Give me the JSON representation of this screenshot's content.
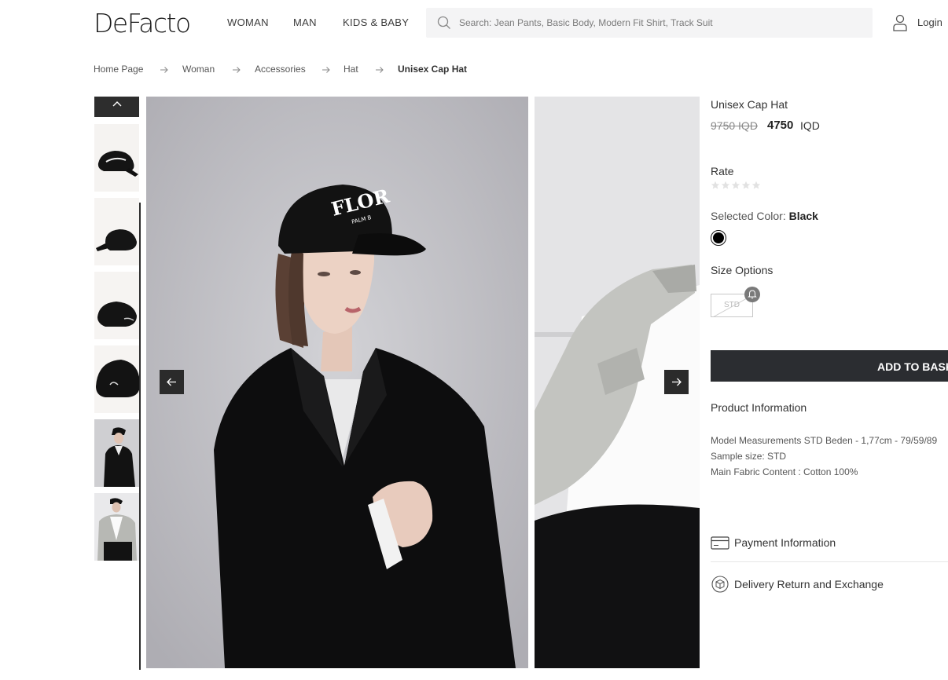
{
  "header": {
    "logo": "DeFacto",
    "nav": [
      "WOMAN",
      "MAN",
      "KIDS & BABY"
    ],
    "search_placeholder": "Search: Jean Pants, Basic Body, Modern Fit Shirt, Track Suit",
    "login_label": "Login"
  },
  "breadcrumb": [
    "Home Page",
    "Woman",
    "Accessories",
    "Hat",
    "Unisex Cap Hat"
  ],
  "gallery": {
    "cap_text": "FLOR",
    "cap_subtext": "PALM B"
  },
  "product": {
    "title": "Unisex Cap Hat",
    "old_price": "9750 IQD",
    "new_price": "4750",
    "currency": "IQD",
    "rate_label": "Rate",
    "rating": 0,
    "selected_color_label": "Selected Color:",
    "selected_color_value": "Black",
    "size_label": "Size Options",
    "sizes": [
      "STD"
    ],
    "add_to_basket": "ADD TO BASKET",
    "info_title": "Product Information",
    "info_lines": [
      "Model Measurements STD Beden - 1,77cm - 79/59/89",
      "Sample size: STD",
      "Main Fabric Content : Cotton 100%"
    ],
    "accordions": [
      "Payment Information",
      "Delivery Return and Exchange"
    ]
  },
  "colors": {
    "dark_button": "#2b2d31",
    "swatch_black": "#000000",
    "search_bg": "#f4f4f5"
  }
}
